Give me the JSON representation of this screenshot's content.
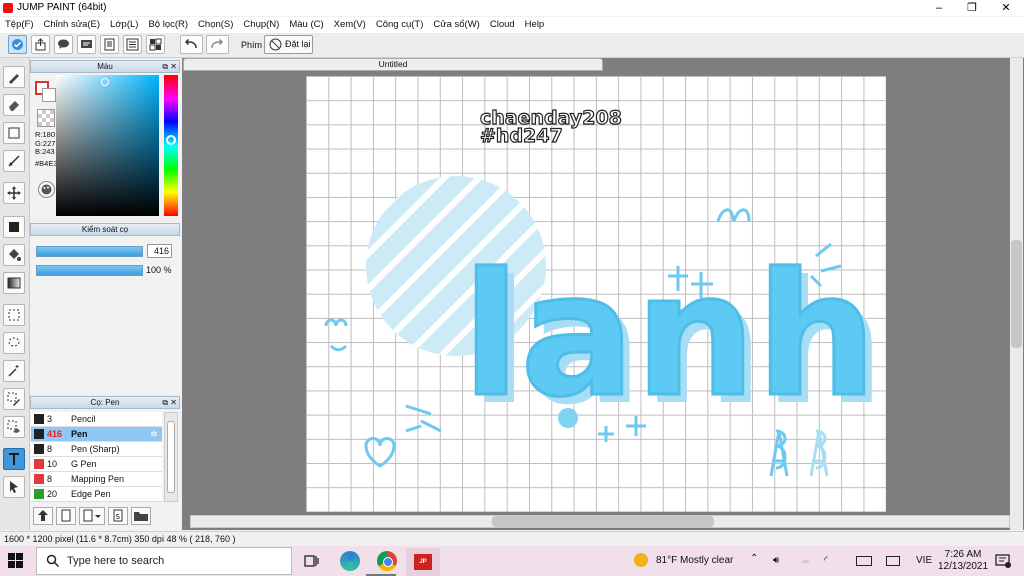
{
  "window": {
    "title": "JUMP PAINT (64bit)"
  },
  "menu": [
    "Tệp(F)",
    "Chỉnh sửa(E)",
    "Lớp(L)",
    "Bộ lọc(R)",
    "Chọn(S)",
    "Chụp(N)",
    "Màu (C)",
    "Xem(V)",
    "Công cụ(T)",
    "Cửa sổ(W)",
    "Cloud",
    "Help"
  ],
  "toolbar": {
    "key_label": "Phím",
    "reset_label": "Đặt lại"
  },
  "color_panel": {
    "title": "Màu",
    "r": "R:180",
    "g": "G:227",
    "b": "B:243",
    "hex": "#B4E3F3"
  },
  "brush_control": {
    "title": "Kiểm soát cọ",
    "size_value": "416",
    "opacity_value": "100 %"
  },
  "brush_list": {
    "title": "Cọ: Pen",
    "items": [
      {
        "size": "3",
        "name": "Pencil",
        "color": "#222222"
      },
      {
        "size": "416",
        "name": "Pen",
        "color": "#222222"
      },
      {
        "size": "8",
        "name": "Pen (Sharp)",
        "color": "#222222"
      },
      {
        "size": "10",
        "name": "G Pen",
        "color": "#e23a3a"
      },
      {
        "size": "8",
        "name": "Mapping Pen",
        "color": "#e23a3a"
      },
      {
        "size": "20",
        "name": "Edge Pen",
        "color": "#2aa02a"
      }
    ]
  },
  "document": {
    "tab_title": "Untitled"
  },
  "artwork": {
    "line1": "chaenday208",
    "line2": "#hd247",
    "word": "lanh"
  },
  "status": {
    "text": "1600 * 1200 pixel  (11.6 * 8.7cm)  350 dpi  48 %  ( 218, 760 )"
  },
  "taskbar": {
    "search_placeholder": "Type here to search",
    "weather": "81°F  Mostly clear",
    "lang": "VIE",
    "time": "7:26 AM",
    "date": "12/13/2021"
  },
  "colors": {
    "accent": "#3f96d8",
    "art_blue": "#5ccaf2",
    "art_light": "#bfe6f5"
  }
}
